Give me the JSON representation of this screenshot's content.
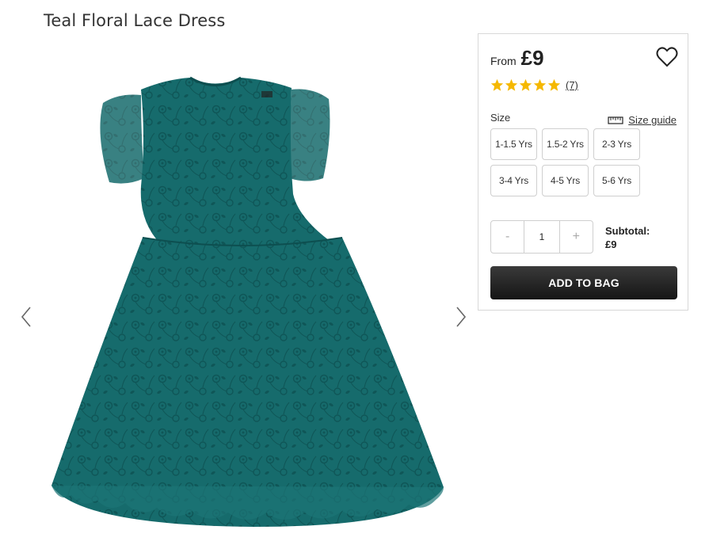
{
  "product": {
    "title": "Teal Floral Lace Dress",
    "image_icon": "teal-lace-dress-image",
    "color": "#14686a"
  },
  "gallery": {
    "prev_icon": "chevron-left-icon",
    "next_icon": "chevron-right-icon"
  },
  "buy_box": {
    "from_label": "From",
    "price": "£9",
    "wishlist_icon": "heart-icon",
    "rating": {
      "stars": 5,
      "count": "(7)",
      "star_color": "#f5b800"
    },
    "size_label": "Size",
    "size_guide_label": "Size guide",
    "size_guide_icon": "ruler-icon",
    "sizes": [
      "1-1.5 Yrs",
      "1.5-2 Yrs",
      "2-3 Yrs",
      "3-4 Yrs",
      "4-5 Yrs",
      "5-6 Yrs"
    ],
    "quantity": {
      "minus": "-",
      "value": "1",
      "plus": "+"
    },
    "subtotal_label": "Subtotal:",
    "subtotal_value": "£9",
    "add_to_bag_label": "ADD TO BAG"
  }
}
